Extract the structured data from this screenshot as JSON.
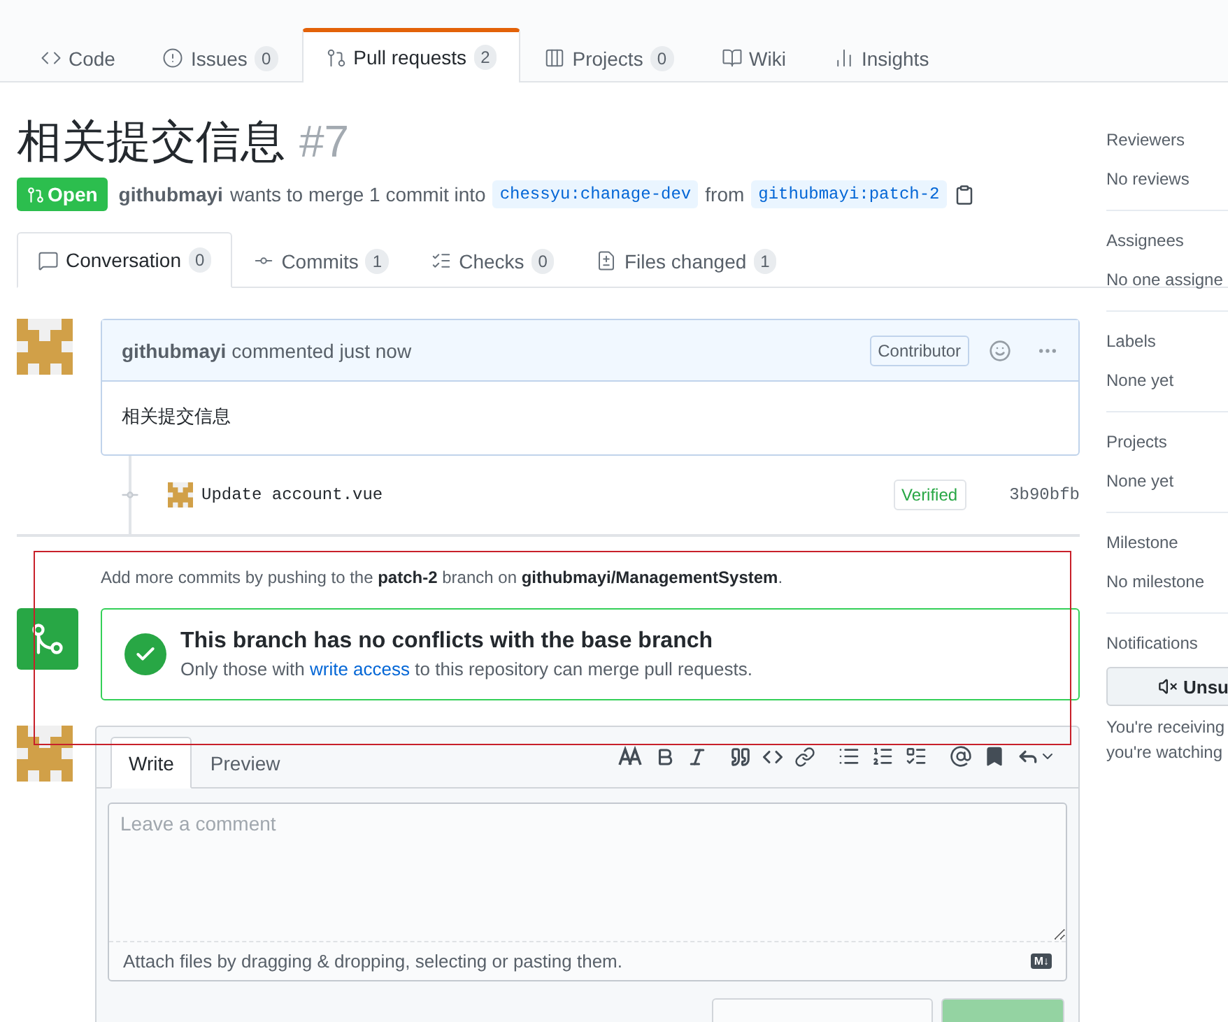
{
  "repo_nav": {
    "tabs": [
      {
        "label": "Code",
        "selected": false
      },
      {
        "label": "Issues",
        "count": "0",
        "selected": false
      },
      {
        "label": "Pull requests",
        "count": "2",
        "selected": true
      },
      {
        "label": "Projects",
        "count": "0",
        "selected": false
      },
      {
        "label": "Wiki",
        "selected": false
      },
      {
        "label": "Insights",
        "selected": false
      }
    ]
  },
  "pull_request": {
    "title": "相关提交信息",
    "number": "#7",
    "state": "Open",
    "author": "githubmayi",
    "merge_text": "wants to merge 1 commit into",
    "base": "chessyu:chanage-dev",
    "from": "from",
    "head": "githubmayi:patch-2"
  },
  "pr_tabs": [
    {
      "label": "Conversation",
      "count": "0",
      "selected": true
    },
    {
      "label": "Commits",
      "count": "1",
      "selected": false
    },
    {
      "label": "Checks",
      "count": "0",
      "selected": false
    },
    {
      "label": "Files changed",
      "count": "1",
      "selected": false
    }
  ],
  "comment": {
    "author": "githubmayi",
    "meta": "commented just now",
    "role": "Contributor",
    "body": "相关提交信息"
  },
  "commits": [
    {
      "message": "Update account.vue",
      "badge": "Verified",
      "sha": "3b90bfb"
    }
  ],
  "push_hint": "Add more commits by pushing to the **patch-2** branch on **githubmayi/ManagementSystem**.",
  "merge_status": {
    "title": "This branch has no conflicts with the base branch",
    "text_before": "Only those with",
    "link": "write access",
    "text_after": "to this repository can merge pull requests."
  },
  "editor": {
    "tabs": [
      {
        "label": "Write",
        "selected": true
      },
      {
        "label": "Preview",
        "selected": false
      }
    ],
    "placeholder": "Leave a comment",
    "attach_hint": "Attach files by dragging & dropping, selecting or pasting them.",
    "markdown_badge": "M↓"
  },
  "sidebar": [
    {
      "heading": "Reviewers",
      "value": "No reviews"
    },
    {
      "heading": "Assignees",
      "value": "No one assigne"
    },
    {
      "heading": "Labels",
      "value": "None yet"
    },
    {
      "heading": "Projects",
      "value": "None yet"
    },
    {
      "heading": "Milestone",
      "value": "No milestone"
    }
  ],
  "notifications": {
    "heading": "Notifications",
    "button": "Unsu",
    "text_lines": [
      "You're receiving",
      "you're watching"
    ]
  }
}
